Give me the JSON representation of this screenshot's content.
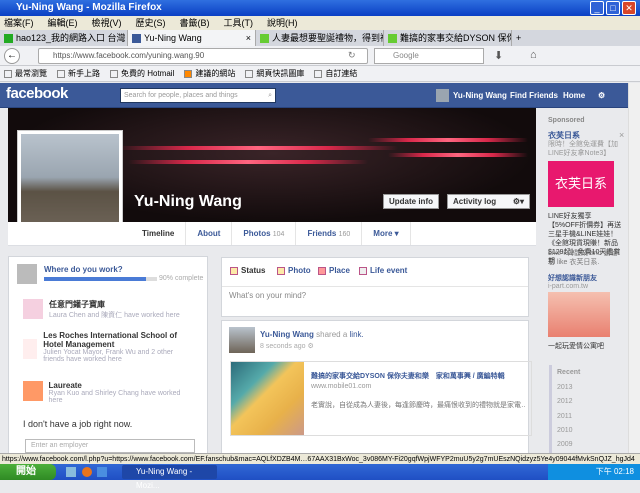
{
  "window": {
    "title": "Yu-Ning Wang - Mozilla Firefox"
  },
  "menu": [
    "檔案(F)",
    "編輯(E)",
    "檢視(V)",
    "歷史(S)",
    "書籤(B)",
    "工具(T)",
    "說明(H)"
  ],
  "tabs": [
    {
      "label": "hao123_我的網路入口 台灣"
    },
    {
      "label": "Yu-Ning Wang"
    },
    {
      "label": "人妻最想要聖誕禮物，得到禮物的員…"
    },
    {
      "label": "難搞的家事交給DYSON 保你夫妻和…"
    }
  ],
  "url": "https://www.facebook.com/yuning.wang.90",
  "search_engine": "Google",
  "bookmarks": [
    "最常瀏覽",
    "新手上路",
    "免費的 Hotmail",
    "建議的網站",
    "網頁快訊圖庫",
    "自訂連結"
  ],
  "fb": {
    "logo": "facebook",
    "search_placeholder": "Search for people, places and things",
    "user": "Yu-Ning Wang",
    "find_friends": "Find Friends",
    "home": "Home"
  },
  "profile": {
    "name": "Yu-Ning Wang",
    "update_info": "Update info",
    "activity_log": "Activity log",
    "tabs": [
      {
        "label": "Timeline"
      },
      {
        "label": "About"
      },
      {
        "label": "Photos",
        "count": "104"
      },
      {
        "label": "Friends",
        "count": "160"
      },
      {
        "label": "More"
      }
    ]
  },
  "work": {
    "title": "Where do you work?",
    "progress_pct": 90,
    "progress_label": "90% complete",
    "jobs": [
      {
        "name": "任意門鑵子寶庫",
        "sub": "Laura Chen and 陳資仁 have worked here"
      },
      {
        "name": "Les Roches International School of Hotel Management",
        "sub": "Julien Yocat Mayor, Frank Wu and 2 other friends have worked here"
      },
      {
        "name": "Laureate",
        "sub": "Ryan Kuo and Shirley Chang have worked here"
      }
    ],
    "no_job": "I don't have a job right now.",
    "employer_placeholder": "Enter an employer"
  },
  "composer": {
    "status": "Status",
    "photo": "Photo",
    "place": "Place",
    "life_event": "Life event",
    "placeholder": "What's on your mind?"
  },
  "story": {
    "author": "Yu-Ning Wang",
    "action": "shared a",
    "link_word": "link.",
    "time": "8 seconds ago",
    "link_title": "難搞的家事交給DYSON 保你夫妻和樂　家和萬事興 / 廣編特輯",
    "link_domain": "www.mobile01.com",
    "link_desc": "老實說，自從成為人妻後，每逢節慶時，最痛恨收到的禮物就是家電…"
  },
  "sidebar": {
    "sponsored": "Sponsored",
    "ad_title": "衣芙日系",
    "ad_sub": "限時！全館免運費【加LINE好友拿Note3】",
    "ad_image_text": "衣芙日系",
    "ad_body": "LINE好友獨享【5%OFF折價券】再送三星手機&LINE娃娃！《全館現貨現賺！新品$129起》免費10天鑑賞期",
    "ad_like": "Like · 梅馥娟 and 劉怡君 like 衣芙日系.",
    "ad2_title": "好想認識新朋友",
    "ad2_domain": "i-part.com.tw",
    "ad2_caption": "一起玩愛情公寓吧",
    "years": [
      "Recent",
      "2013",
      "2012",
      "2011",
      "2010",
      "2009"
    ]
  },
  "statusbar": "https://www.facebook.com/l.php?u=https://www.facebook.com/EF.fanschub&mac=AQLfXDZB4M…67AAX31BxWoc_3v086MY-Fi20gqfWpjWFYP2muU5y2g7mUEszNQidzyz5Ye4y09044fMvkSnQJZ_hgJd4",
  "taskbar": {
    "start": "開始",
    "task": "Yu-Ning Wang - Mozi...",
    "clock": "下午 02:18"
  }
}
